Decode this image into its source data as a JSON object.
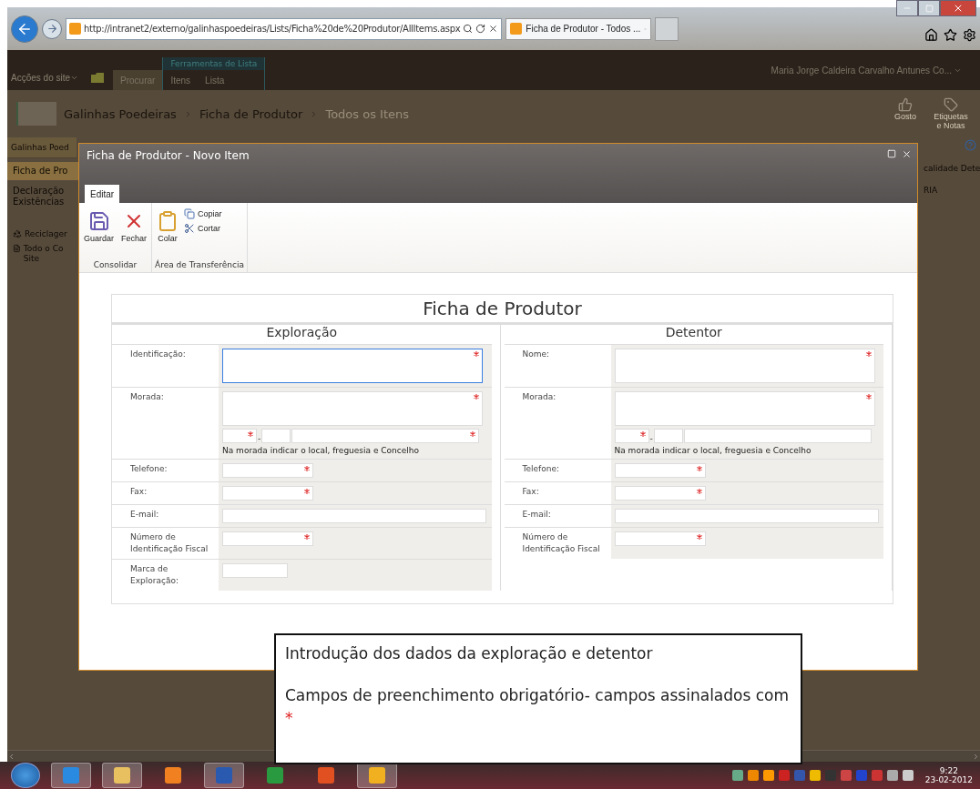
{
  "browser": {
    "url": "http://intranet2/externo/galinhaspoedeiras/Lists/Ficha%20de%20Produtor/AllItems.aspx",
    "tabs": [
      {
        "label": "Ficha de Produtor - Todos ...",
        "selected": true
      }
    ]
  },
  "site": {
    "site_actions": "Acções do site",
    "tabs": [
      {
        "label": "Procurar",
        "selected": true
      },
      {
        "label": "Itens",
        "selected": false
      },
      {
        "label": "Lista",
        "selected": false
      }
    ],
    "tool_group": "Ferramentas de Lista",
    "user": "Maria Jorge Caldeira Carvalho Antunes Co...",
    "breadcrumb": [
      {
        "label": "Galinhas Poedeiras",
        "current": false
      },
      {
        "label": "Ficha de Produtor",
        "current": false
      },
      {
        "label": "Todos os Itens",
        "current": true
      }
    ],
    "social": [
      "Gosto",
      "Etiquetas e Notas"
    ],
    "nav_header": "Galinhas Poed",
    "nav": [
      {
        "label": "Ficha de Pro",
        "selected": true
      },
      {
        "label": "Declaração Existências",
        "selected": false
      }
    ],
    "nav_links": [
      {
        "label": "Reciclager",
        "kind": "recycle"
      },
      {
        "label": "Todo o Co Site",
        "kind": "content"
      }
    ],
    "column_fragment": "calidade Dete",
    "cell_fragment": "RIA"
  },
  "dialog": {
    "title": "Ficha de Produtor - Novo Item",
    "ribbon_tabs": [
      {
        "label": "Editar",
        "selected": true
      }
    ],
    "groups": [
      {
        "label": "Consolidar",
        "buttons": [
          {
            "label": "Guardar",
            "kind": "save"
          },
          {
            "label": "Fechar",
            "kind": "close"
          }
        ]
      },
      {
        "label": "Área de Transferência",
        "buttons": [
          {
            "label": "Colar",
            "kind": "paste"
          },
          {
            "label": "Copiar",
            "kind": "copy"
          },
          {
            "label": "Cortar",
            "kind": "cut"
          }
        ]
      }
    ],
    "form": {
      "title": "Ficha de Produtor",
      "sections": [
        {
          "title": "Exploração",
          "rows": [
            {
              "label": "Identificação:",
              "fields": [
                {
                  "kind": "multiline",
                  "required": true,
                  "focused": true
                }
              ]
            },
            {
              "label": "Morada:",
              "fields": [
                {
                  "kind": "multiline",
                  "required": true,
                  "focused": false
                }
              ],
              "postcode": [
                {
                  "kind": "code",
                  "required": true
                },
                {
                  "kind": "ext",
                  "required": false
                },
                {
                  "kind": "locality",
                  "required": true
                }
              ],
              "separator": "-",
              "hint": "Na morada indicar o local, freguesia e Concelho"
            },
            {
              "label": "Telefone:",
              "fields": [
                {
                  "kind": "narrow",
                  "required": true,
                  "focused": false
                }
              ]
            },
            {
              "label": "Fax:",
              "fields": [
                {
                  "kind": "narrow",
                  "required": true,
                  "focused": false
                }
              ]
            },
            {
              "label": "E-mail:",
              "fields": [
                {
                  "kind": "wide",
                  "required": false,
                  "focused": false
                }
              ]
            },
            {
              "label": "Número de Identificação Fiscal",
              "fields": [
                {
                  "kind": "narrow",
                  "required": true,
                  "focused": false
                }
              ]
            },
            {
              "label": "Marca de Exploração:",
              "fields": [
                {
                  "kind": "tiny",
                  "required": false,
                  "focused": false
                }
              ]
            }
          ]
        },
        {
          "title": "Detentor",
          "rows": [
            {
              "label": "Nome:",
              "fields": [
                {
                  "kind": "multiline",
                  "required": true,
                  "focused": false
                }
              ]
            },
            {
              "label": "Morada:",
              "fields": [
                {
                  "kind": "multiline",
                  "required": true,
                  "focused": false
                }
              ],
              "postcode": [
                {
                  "kind": "code",
                  "required": true
                },
                {
                  "kind": "ext",
                  "required": false
                },
                {
                  "kind": "locality",
                  "required": false
                }
              ],
              "separator": "-",
              "hint": "Na morada indicar o local, freguesia e Concelho"
            },
            {
              "label": "Telefone:",
              "fields": [
                {
                  "kind": "narrow",
                  "required": true,
                  "focused": false
                }
              ]
            },
            {
              "label": "Fax:",
              "fields": [
                {
                  "kind": "narrow",
                  "required": true,
                  "focused": false
                }
              ]
            },
            {
              "label": "E-mail:",
              "fields": [
                {
                  "kind": "wide",
                  "required": false,
                  "focused": false
                }
              ]
            },
            {
              "label": "Número de Identificação Fiscal",
              "fields": [
                {
                  "kind": "narrow",
                  "required": true,
                  "focused": false
                }
              ]
            }
          ]
        }
      ]
    }
  },
  "callout": {
    "lines": [
      "Introdução dos dados da exploração e detentor",
      "Campos de preenchimento obrigatório- campos assinalados com"
    ],
    "marker": "*"
  },
  "taskbar": {
    "apps": [
      {
        "kind": "ie",
        "selected": true
      },
      {
        "kind": "folder",
        "selected": true
      },
      {
        "kind": "media",
        "selected": false
      },
      {
        "kind": "word",
        "selected": true
      },
      {
        "kind": "excel",
        "selected": false
      },
      {
        "kind": "powerpoint",
        "selected": false
      },
      {
        "kind": "outlook",
        "selected": true
      }
    ],
    "time": "9:22",
    "date": "23-02-2012"
  }
}
